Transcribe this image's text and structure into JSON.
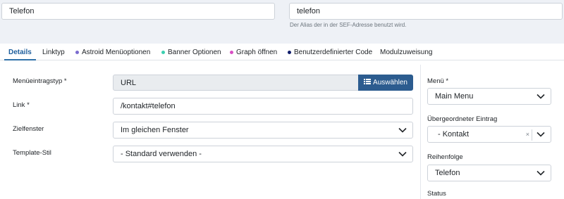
{
  "title_field": {
    "value": "Telefon"
  },
  "alias_field": {
    "value": "telefon",
    "hint": "Der Alias der in der SEF-Adresse benutzt wird."
  },
  "tabs": [
    {
      "label": "Details",
      "active": true
    },
    {
      "label": "Linktyp"
    },
    {
      "label": "Astroid Menüoptionen",
      "dot": "#7b6ccf"
    },
    {
      "label": "Banner Optionen",
      "dot": "#3ccfb0"
    },
    {
      "label": "Graph öffnen",
      "dot": "#d94fc4"
    },
    {
      "label": "Benutzerdefinierter Code",
      "dot": "#0f1d6b"
    },
    {
      "label": "Modulzuweisung"
    }
  ],
  "form": {
    "menu_item_type": {
      "label": "Menüeintragstyp *",
      "value": "URL",
      "button": "Auswählen"
    },
    "link": {
      "label": "Link *",
      "value": "/kontakt#telefon"
    },
    "target_window": {
      "label": "Zielfenster",
      "value": "Im gleichen Fenster"
    },
    "template_style": {
      "label": "Template-Stil",
      "value": "- Standard verwenden -"
    }
  },
  "sidebar": {
    "menu": {
      "label": "Menü *",
      "value": "Main Menu"
    },
    "parent": {
      "label": "Übergeordneter Eintrag",
      "value": "- Kontakt",
      "clear": "×"
    },
    "ordering": {
      "label": "Reihenfolge",
      "value": "Telefon"
    },
    "status": {
      "label": "Status"
    }
  }
}
